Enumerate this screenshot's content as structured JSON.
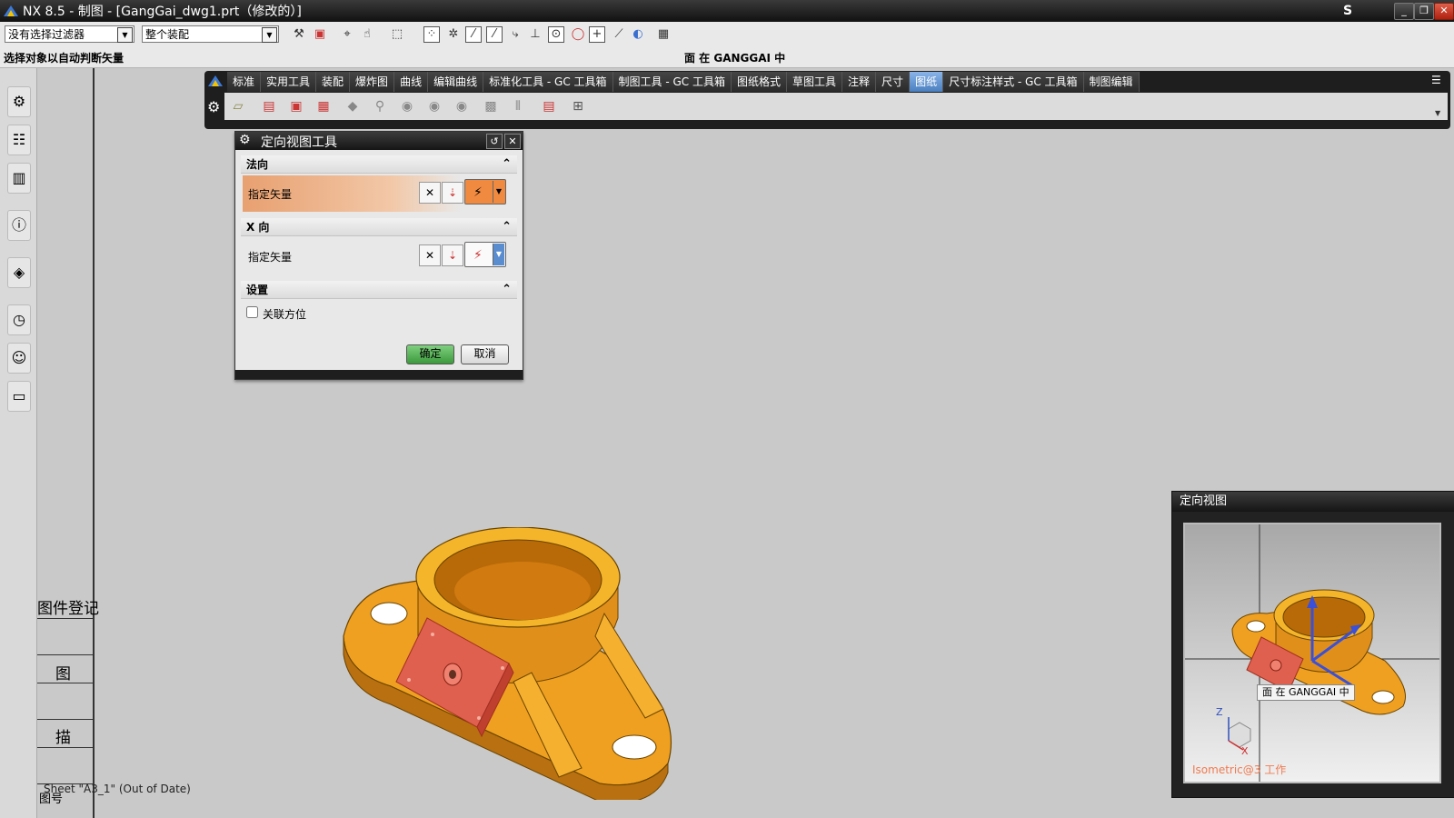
{
  "window": {
    "title": "NX 8.5 - 制图 - [GangGai_dwg1.prt（修改的）]",
    "corner_mark": "S",
    "buttons": [
      "minimize",
      "restore",
      "close"
    ]
  },
  "selection_bar": {
    "filter_value": "没有选择过滤器",
    "scope_value": "整个装配"
  },
  "cue_line": {
    "prompt": "选择对象以自动判断矢量",
    "status": "面 在 GANGGAI 中"
  },
  "ribbon": {
    "tabs": [
      {
        "label": "标准"
      },
      {
        "label": "实用工具"
      },
      {
        "label": "装配"
      },
      {
        "label": "爆炸图"
      },
      {
        "label": "曲线"
      },
      {
        "label": "编辑曲线"
      },
      {
        "label": "标准化工具 - GC 工具箱"
      },
      {
        "label": "制图工具 - GC 工具箱"
      },
      {
        "label": "图纸格式"
      },
      {
        "label": "草图工具"
      },
      {
        "label": "注释"
      },
      {
        "label": "尺寸"
      },
      {
        "label": "图纸",
        "active": true
      },
      {
        "label": "尺寸标注样式 - GC 工具箱"
      },
      {
        "label": "制图编辑"
      }
    ]
  },
  "dialog": {
    "title": "定向视图工具",
    "sections": {
      "normal": {
        "header": "法向",
        "row_label": "指定矢量"
      },
      "xdir": {
        "header": "X 向",
        "row_label": "指定矢量"
      },
      "settings": {
        "header": "设置",
        "checkbox_label": "关联方位",
        "checked": false
      }
    },
    "ok_label": "确定",
    "cancel_label": "取消"
  },
  "orient_view": {
    "title": "定向视图",
    "tooltip": "面 在 GANGGAI 中",
    "view_label": "Isometric@3 工作",
    "axis_z": "Z",
    "axis_x": "X"
  },
  "drawing": {
    "titleblock_texts": [
      "图件登记",
      "图",
      "描",
      "图号"
    ]
  },
  "sheet_label": "Sheet \"A3_1\" (Out of Date)",
  "colors": {
    "part_orange": "#f0a020",
    "face_highlight": "#e06050",
    "active_tab": "#5a8cd0",
    "ok_button": "#4caf50"
  }
}
